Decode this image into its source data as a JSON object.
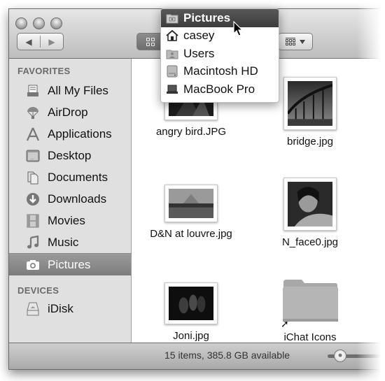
{
  "window": {
    "traffic_lights": [
      "close",
      "minimize",
      "zoom"
    ],
    "nav": {
      "back_icon": "back-arrow-icon",
      "forward_icon": "forward-arrow-icon"
    },
    "view_buttons": [
      {
        "name": "icon-view",
        "icon": "grid-icon",
        "active": true
      },
      {
        "name": "arrange",
        "icon": "arrange-grid-icon",
        "active": false
      }
    ]
  },
  "path_popup": {
    "items": [
      {
        "label": "Pictures",
        "icon": "pictures-folder-icon",
        "highlighted": true
      },
      {
        "label": "casey",
        "icon": "home-icon",
        "highlighted": false
      },
      {
        "label": "Users",
        "icon": "users-folder-icon",
        "highlighted": false
      },
      {
        "label": "Macintosh HD",
        "icon": "hard-drive-icon",
        "highlighted": false
      },
      {
        "label": "MacBook Pro",
        "icon": "laptop-icon",
        "highlighted": false
      }
    ]
  },
  "sidebar": {
    "favorites_heading": "FAVORITES",
    "favorites": [
      {
        "label": "All My Files",
        "icon": "all-files-icon"
      },
      {
        "label": "AirDrop",
        "icon": "airdrop-icon"
      },
      {
        "label": "Applications",
        "icon": "applications-icon"
      },
      {
        "label": "Desktop",
        "icon": "desktop-icon"
      },
      {
        "label": "Documents",
        "icon": "documents-icon"
      },
      {
        "label": "Downloads",
        "icon": "downloads-icon"
      },
      {
        "label": "Movies",
        "icon": "movies-icon"
      },
      {
        "label": "Music",
        "icon": "music-icon"
      },
      {
        "label": "Pictures",
        "icon": "camera-icon",
        "selected": true
      }
    ],
    "devices_heading": "DEVICES",
    "devices": [
      {
        "label": "iDisk",
        "icon": "idisk-icon"
      }
    ]
  },
  "files": [
    {
      "name": "angry bird.JPG",
      "kind": "photo"
    },
    {
      "name": "bridge.jpg",
      "kind": "photo"
    },
    {
      "name": "D&N at louvre.jpg",
      "kind": "photo"
    },
    {
      "name": "N_face0.jpg",
      "kind": "photo"
    },
    {
      "name": "Joni.jpg",
      "kind": "photo"
    },
    {
      "name": "iChat Icons",
      "kind": "folder-alias"
    }
  ],
  "status": {
    "text": "15 items, 385.8 GB available",
    "icon_size_slider": 0.1
  }
}
